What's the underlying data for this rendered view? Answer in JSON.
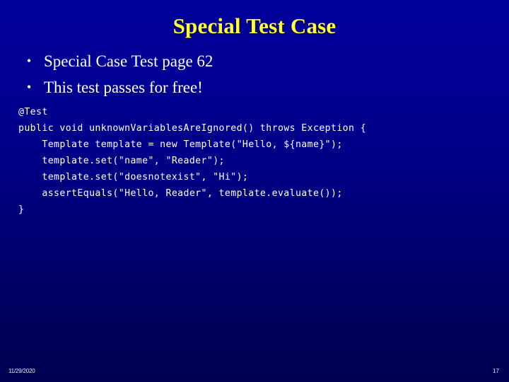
{
  "slide": {
    "title": "Special Test Case",
    "title_color": "#FFFF33",
    "background_top_color": "#00009B",
    "background_bottom_color": "#000052",
    "body_text_color": "#FFFFFF"
  },
  "bullets": [
    {
      "marker": "•",
      "text": "Special Case Test page 62"
    },
    {
      "marker": "•",
      "text": "This test passes for free!"
    }
  ],
  "code": {
    "language": "java",
    "lines": [
      "@Test",
      "public void unknownVariablesAreIgnored() throws Exception {",
      "    Template template = new Template(\"Hello, ${name}\");",
      "    template.set(\"name\", \"Reader\");",
      "    template.set(\"doesnotexist\", \"Hi\");",
      "    assertEquals(\"Hello, Reader\", template.evaluate());",
      "}"
    ]
  },
  "footer": {
    "date": "11/29/2020",
    "page_number": "17"
  }
}
